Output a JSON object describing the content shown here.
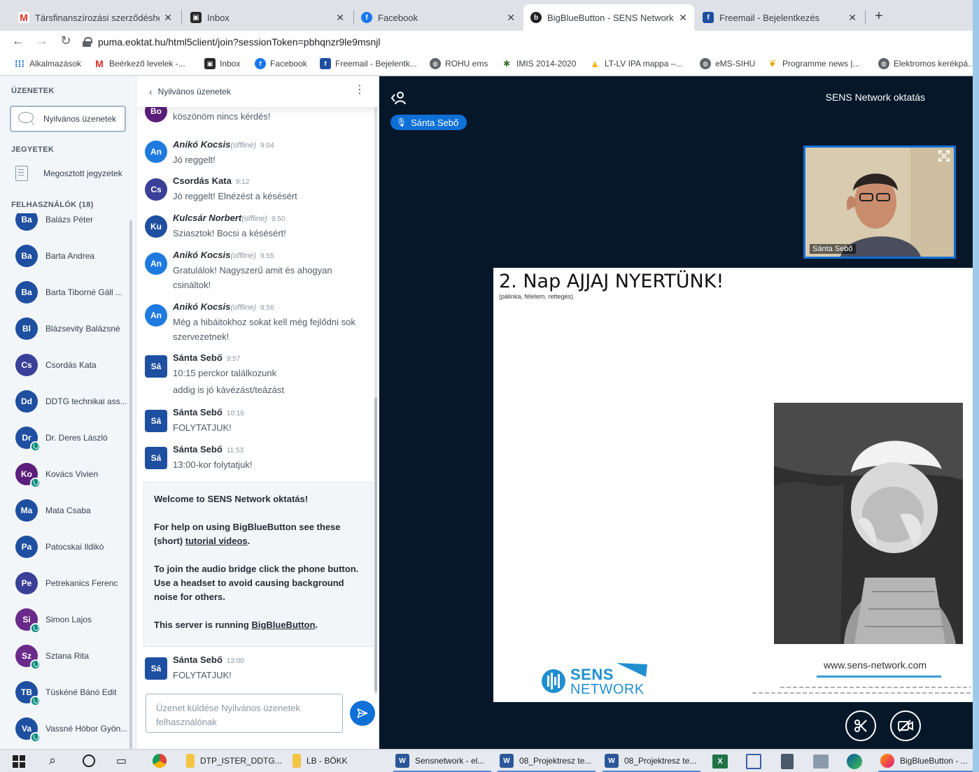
{
  "browser": {
    "tabs": [
      {
        "title": "Társfinanszírozási szerződéshez c",
        "favicon": "gmail-icon",
        "active": false
      },
      {
        "title": "Inbox",
        "favicon": "inbox-icon",
        "active": false
      },
      {
        "title": "Facebook",
        "favicon": "facebook-icon",
        "active": false
      },
      {
        "title": "BigBlueButton - SENS Network o",
        "favicon": "bigbluebutton-icon",
        "active": true
      },
      {
        "title": "Freemail - Bejelentkezés",
        "favicon": "freemail-icon",
        "active": false
      }
    ],
    "new_tab_label": "+",
    "url": "puma.eoktat.hu/html5client/join?sessionToken=pbhqnzr9le9msnjl",
    "bookmarks": [
      {
        "label": "Alkalmazások"
      },
      {
        "label": "Beérkező levelek -..."
      },
      {
        "label": "Inbox"
      },
      {
        "label": "Facebook"
      },
      {
        "label": "Freemail - Bejelentk..."
      },
      {
        "label": "ROHU ems"
      },
      {
        "label": "IMIS 2014-2020"
      },
      {
        "label": "LT-LV IPA mappa –..."
      },
      {
        "label": "eMS-SIHU"
      },
      {
        "label": "Programme news |..."
      },
      {
        "label": "Elektromos kerékpá..."
      }
    ]
  },
  "sidebar": {
    "messages_heading": "ÜZENETEK",
    "public_chat_label": "Nyilvános üzenetek",
    "notes_heading": "JEGYETEK",
    "shared_notes_label": "Megosztott jegyzetek",
    "users_heading": "FELHASZNÁLÓK (18)",
    "users": [
      {
        "initials": "Ba",
        "name": "Balázs Péter",
        "color": "#1e4fa0",
        "mic": false
      },
      {
        "initials": "Ba",
        "name": "Barta Andrea",
        "color": "#1e4fa0",
        "mic": false
      },
      {
        "initials": "Ba",
        "name": "Barta Tiborné Gáll ...",
        "color": "#1e4fa0",
        "mic": false
      },
      {
        "initials": "Bl",
        "name": "Blázsevity Balázsné",
        "color": "#1e4fa0",
        "mic": false
      },
      {
        "initials": "Cs",
        "name": "Csordás Kata",
        "color": "#3a3f98",
        "mic": false
      },
      {
        "initials": "Dd",
        "name": "DDTG technikai ass...",
        "color": "#1e4fa0",
        "mic": false
      },
      {
        "initials": "Dr",
        "name": "Dr. Deres László",
        "color": "#1e4fa0",
        "mic": true
      },
      {
        "initials": "Ko",
        "name": "Kovács Vivien",
        "color": "#5b1e7a",
        "mic": true
      },
      {
        "initials": "Ma",
        "name": "Mata Csaba",
        "color": "#1e4fa0",
        "mic": false
      },
      {
        "initials": "Pa",
        "name": "Patocskai Ildikó",
        "color": "#1e4fa0",
        "mic": false
      },
      {
        "initials": "Pe",
        "name": "Petrekanics Ferenc",
        "color": "#3a3f98",
        "mic": false
      },
      {
        "initials": "Si",
        "name": "Simon Lajos",
        "color": "#6a2a8a",
        "mic": true
      },
      {
        "initials": "Sz",
        "name": "Sztana Rita",
        "color": "#6a2a8a",
        "mic": true
      },
      {
        "initials": "TB",
        "name": "Tüskéné Bánó Edit",
        "color": "#1e4fa0",
        "mic": true
      },
      {
        "initials": "Va",
        "name": "Vassné Hóbor Gyön...",
        "color": "#1e4fa0",
        "mic": true
      }
    ]
  },
  "chat": {
    "title": "Nyilvános üzenetek",
    "messages": [
      {
        "initials": "Bo",
        "color": "#5b1e7a",
        "square": false,
        "name": "",
        "offline": "",
        "time": "",
        "lines": [
          "köszönöm nincs kérdés!"
        ]
      },
      {
        "initials": "An",
        "color": "#1f7ae0",
        "square": false,
        "name": "Anikó Kocsis",
        "offline": "(offline)",
        "time": "9:04",
        "lines": [
          "Jó reggelt!"
        ]
      },
      {
        "initials": "Cs",
        "color": "#3a3f98",
        "square": false,
        "name": "Csordás Kata",
        "offline": "",
        "time": "9:12",
        "lines": [
          "Jó reggelt! Elnézést a késésért"
        ]
      },
      {
        "initials": "Ku",
        "color": "#1e4fa0",
        "square": false,
        "name": "Kulcsár Norbert",
        "offline": "(offline)",
        "time": "9:50",
        "lines": [
          "Sziasztok! Bocsi a késésért!"
        ]
      },
      {
        "initials": "An",
        "color": "#1f7ae0",
        "square": false,
        "name": "Anikó Kocsis",
        "offline": "(offline)",
        "time": "9:55",
        "lines": [
          "Gratulálok! Nagyszerű amit és ahogyan",
          "csináltok!"
        ]
      },
      {
        "initials": "An",
        "color": "#1f7ae0",
        "square": false,
        "name": "Anikó Kocsis",
        "offline": "(offline)",
        "time": "9:56",
        "lines": [
          "Még a hibáitokhoz sokat kell még fejlődni sok",
          "szervezetnek!"
        ]
      },
      {
        "initials": "Sá",
        "color": "#1e4fa0",
        "square": true,
        "name": "Sánta Sebő",
        "offline": "",
        "time": "9:57",
        "lines": [
          "10:15 perckor találkozunk",
          "addig is jó kávézást/teázást"
        ]
      },
      {
        "initials": "Sá",
        "color": "#1e4fa0",
        "square": true,
        "name": "Sánta Sebő",
        "offline": "",
        "time": "10:16",
        "lines": [
          "FOLYTATJUK!"
        ]
      },
      {
        "initials": "Sá",
        "color": "#1e4fa0",
        "square": true,
        "name": "Sánta Sebő",
        "offline": "",
        "time": "11:53",
        "lines": [
          "13:00-kor folytatjuk!"
        ]
      }
    ],
    "welcome": {
      "heading": "Welcome to SENS Network oktatás!",
      "help_pre": "For help on using BigBlueButton see these",
      "help_mid": "(short) ",
      "help_link": "tutorial videos",
      "help_post": ".",
      "audio_1": "To join the audio bridge click the phone button.",
      "audio_2": "Use a headset to avoid causing background",
      "audio_3": "noise for others.",
      "server_pre": "This server is running ",
      "server_link": "BigBlueButton",
      "server_post": "."
    },
    "last_message": {
      "initials": "Sá",
      "color": "#1e4fa0",
      "name": "Sánta Sebő",
      "time": "13:00",
      "text": "FOLYTATJUK!"
    },
    "input_placeholder_1": "Üzenet küldése Nyilvános üzenetek",
    "input_placeholder_2": "felhasználónak"
  },
  "stage": {
    "meeting_title": "SENS Network oktatás",
    "presenter_name": "Sánta Sebő",
    "webcam_name": "Sánta Sebő",
    "slide": {
      "title": "2. Nap AJJAJ NYERTÜNK!",
      "subtitle": "(pálinka, félelem, rettegés)",
      "website": "www.sens-network.com",
      "logo_line1": "SENS",
      "logo_line2": "NETWORK"
    }
  },
  "taskbar": {
    "items": [
      {
        "label": "DTP_ISTER_DDTG..."
      },
      {
        "label": "LB - BÖKK"
      },
      {
        "label": "Sensnetwork - el..."
      },
      {
        "label": "08_Projektresz te..."
      },
      {
        "label": "08_Projektresz te..."
      },
      {
        "label": "BigBlueButton - ..."
      }
    ]
  },
  "colors": {
    "accent": "#0f70d7",
    "stage_bg": "#06172a",
    "sidebar_bg": "#f3f6f9"
  }
}
